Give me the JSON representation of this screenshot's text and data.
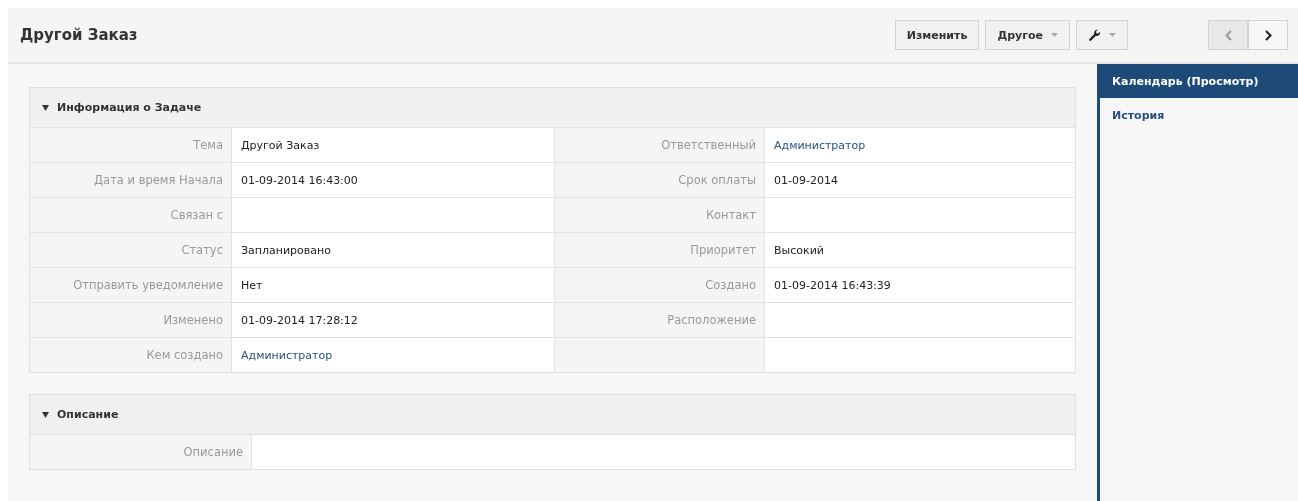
{
  "header": {
    "title": "Другой Заказ",
    "buttons": [
      {
        "kind": "text",
        "label": "Изменить",
        "dropdown": false
      },
      {
        "kind": "text",
        "label": "Другое",
        "dropdown": true
      },
      {
        "kind": "wrench",
        "dropdown": true
      }
    ],
    "nav": [
      {
        "kind": "prev",
        "disabled": true
      },
      {
        "kind": "next",
        "disabled": false
      }
    ]
  },
  "sidebar": {
    "items": [
      {
        "label": "Календарь (Просмотр)",
        "selected": true
      },
      {
        "label": "История",
        "selected": false
      }
    ]
  },
  "panels": [
    {
      "title": "Информация о Задаче",
      "expanded": true,
      "rows": [
        [
          {
            "label": "Тема",
            "value": "Другой Заказ",
            "kind": "text"
          },
          {
            "label": "Ответственный",
            "value": "Администратор",
            "kind": "link"
          }
        ],
        [
          {
            "label": "Дата и время Начала",
            "value": "01-09-2014 16:43:00",
            "kind": "text"
          },
          {
            "label": "Срок оплаты",
            "value": "01-09-2014",
            "kind": "text"
          }
        ],
        [
          {
            "label": "Связан с"
          },
          {
            "label": "Контакт"
          }
        ],
        [
          {
            "label": "Статус",
            "value": "Запланировано",
            "kind": "text"
          },
          {
            "label": "Приоритет",
            "value": "Высокий",
            "kind": "text"
          }
        ],
        [
          {
            "label": "Отправить уведомление",
            "value": "Нет",
            "kind": "text"
          },
          {
            "label": "Создано",
            "value": "01-09-2014 16:43:39",
            "kind": "text"
          }
        ],
        [
          {
            "label": "Изменено",
            "value": "01-09-2014 17:28:12",
            "kind": "text"
          },
          {
            "label": "Расположение"
          }
        ],
        [
          {
            "label": "Кем создано",
            "value": "Администратор",
            "kind": "link"
          },
          {}
        ]
      ]
    },
    {
      "title": "Описание",
      "expanded": true,
      "rows": [
        [
          {
            "label": "Описание"
          }
        ]
      ]
    }
  ]
}
